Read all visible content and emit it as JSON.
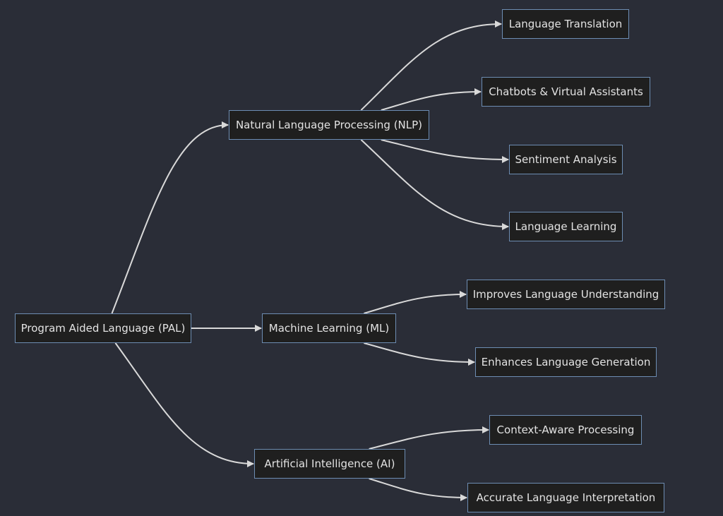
{
  "diagram": {
    "type": "flowchart-left-to-right",
    "colors": {
      "background": "#2a2d37",
      "node_fill": "#1f1f1f",
      "node_border": "#6d8db3",
      "text": "#e3e3e3",
      "edge": "#d9d9d9"
    },
    "nodes": {
      "pal": "Program Aided Language (PAL)",
      "nlp": "Natural Language Processing (NLP)",
      "ml": "Machine Learning (ML)",
      "ai": "Artificial Intelligence (AI)",
      "translation": "Language Translation",
      "chatbots": "Chatbots & Virtual Assistants",
      "sentiment": "Sentiment Analysis",
      "learning": "Language Learning",
      "understanding": "Improves Language Understanding",
      "generation": "Enhances Language Generation",
      "context": "Context-Aware Processing",
      "interpretation": "Accurate Language Interpretation"
    },
    "edges": [
      [
        "pal",
        "nlp"
      ],
      [
        "pal",
        "ml"
      ],
      [
        "pal",
        "ai"
      ],
      [
        "nlp",
        "translation"
      ],
      [
        "nlp",
        "chatbots"
      ],
      [
        "nlp",
        "sentiment"
      ],
      [
        "nlp",
        "learning"
      ],
      [
        "ml",
        "understanding"
      ],
      [
        "ml",
        "generation"
      ],
      [
        "ai",
        "context"
      ],
      [
        "ai",
        "interpretation"
      ]
    ]
  }
}
